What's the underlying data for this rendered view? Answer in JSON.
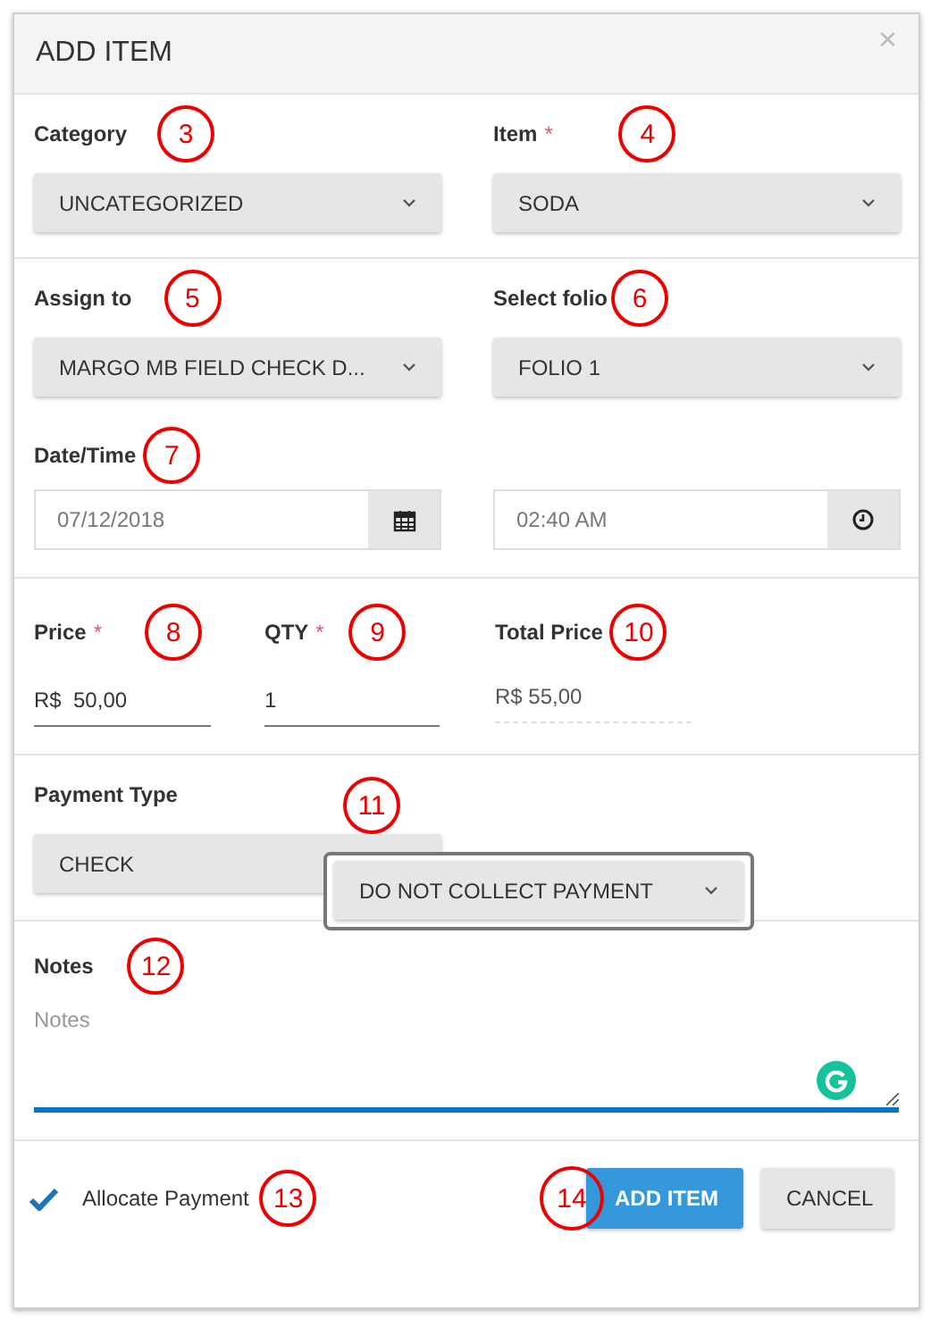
{
  "dialog": {
    "title": "ADD ITEM",
    "close": "×"
  },
  "selects": [
    {
      "label": "Category",
      "value": "UNCATEGORIZED",
      "callout": "3"
    },
    {
      "label": "Item",
      "required_mark": "*",
      "value": "SODA",
      "callout": "4"
    },
    {
      "label": "Assign to",
      "value": "MARGO MB FIELD CHECK D...",
      "callout": "5"
    },
    {
      "label": "Select folio",
      "value": "FOLIO 1",
      "callout": "6"
    }
  ],
  "datetime": {
    "label": "Date/Time",
    "callout": "7",
    "date": "07/12/2018",
    "time": "02:40 AM"
  },
  "amounts": [
    {
      "kind": "input",
      "label": "Price",
      "required_mark": "*",
      "value": "R$  50,00",
      "callout": "8"
    },
    {
      "kind": "input",
      "label": "QTY",
      "required_mark": "*",
      "value": "1",
      "callout": "9"
    },
    {
      "kind": "readonly",
      "label": "Total Price",
      "value": "R$ 55,00",
      "callout": "10"
    }
  ],
  "payment": {
    "label": "Payment Type",
    "value": "CHECK",
    "callout": "11",
    "dropdown": "DO NOT COLLECT PAYMENT"
  },
  "notes": {
    "label": "Notes",
    "placeholder": "Notes",
    "callout": "12"
  },
  "allocate": {
    "label": "Allocate Payment",
    "checked": true,
    "callout": "13"
  },
  "buttons": [
    {
      "label": "ADD ITEM",
      "kind": "primary",
      "callout": "14"
    },
    {
      "label": "CANCEL",
      "kind": "default"
    }
  ]
}
